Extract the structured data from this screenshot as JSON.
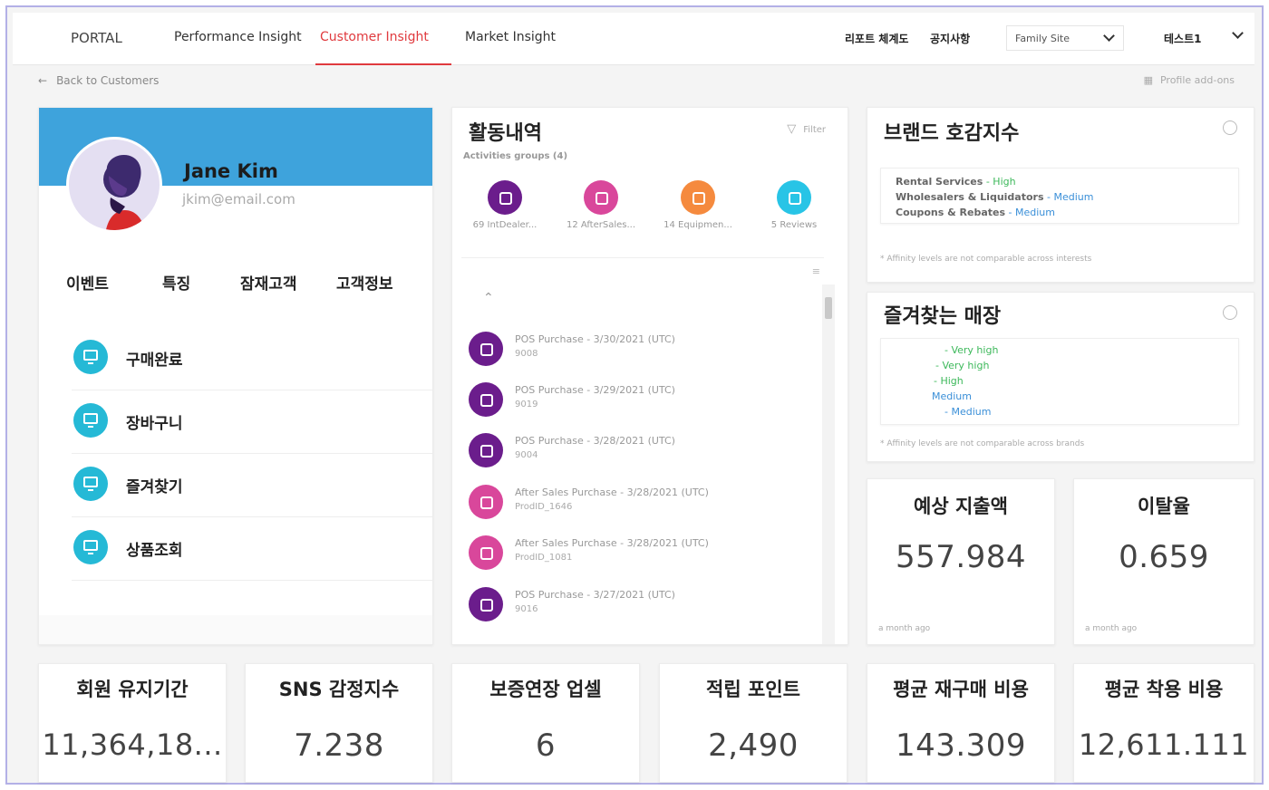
{
  "nav": {
    "portal": "PORTAL",
    "tabs": [
      "Performance Insight",
      "Customer Insight",
      "Market Insight"
    ],
    "active_tab": "Customer Insight",
    "right_links": [
      "리포트 체계도",
      "공지사항"
    ],
    "family_site": "Family Site",
    "user": "테스트1"
  },
  "subbar": {
    "back": "Back to Customers",
    "addons": "Profile add-ons"
  },
  "profile": {
    "name": "Jane Kim",
    "email": "jkim@email.com",
    "tabs": [
      "이벤트",
      "특징",
      "잠재고객",
      "고객정보"
    ],
    "events": [
      "구매완료",
      "장바구니",
      "즐겨찾기",
      "상품조회"
    ]
  },
  "activities": {
    "title": "활동내역",
    "filter": "Filter",
    "groups_label": "Activities groups (4)",
    "groups": [
      {
        "label": "69 IntDealer...",
        "color": "#6b1d8c"
      },
      {
        "label": "12 AfterSales...",
        "color": "#d9479b"
      },
      {
        "label": "14 Equipmen...",
        "color": "#f58a3e"
      },
      {
        "label": "5 Reviews",
        "color": "#28c4e6"
      }
    ],
    "items": [
      {
        "title": "POS Purchase - 3/30/2021 (UTC)",
        "sub": "9008",
        "color": "#6b1d8c"
      },
      {
        "title": "POS Purchase - 3/29/2021 (UTC)",
        "sub": "9019",
        "color": "#6b1d8c"
      },
      {
        "title": "POS Purchase - 3/28/2021 (UTC)",
        "sub": "9004",
        "color": "#6b1d8c"
      },
      {
        "title": "After Sales Purchase - 3/28/2021 (UTC)",
        "sub": "ProdID_1646",
        "color": "#d9479b"
      },
      {
        "title": "After Sales Purchase - 3/28/2021 (UTC)",
        "sub": "ProdID_1081",
        "color": "#d9479b"
      },
      {
        "title": "POS Purchase - 3/27/2021 (UTC)",
        "sub": "9016",
        "color": "#6b1d8c"
      }
    ]
  },
  "brand": {
    "title": "브랜드 호감지수",
    "rows": [
      {
        "name": "Rental Services",
        "level": "High"
      },
      {
        "name": "Wholesalers & Liquidators",
        "level": "Medium"
      },
      {
        "name": "Coupons & Rebates",
        "level": "Medium"
      }
    ],
    "note": "* Affinity levels are not comparable across interests"
  },
  "stores": {
    "title": "즐겨찾는 매장",
    "rows": [
      "- Very high",
      "- Very high",
      "- High",
      "Medium",
      "- Medium"
    ],
    "note": "* Affinity levels are not comparable across brands"
  },
  "metrics_top": [
    {
      "title": "예상 지출액",
      "value": "557.984",
      "foot": "a month ago"
    },
    {
      "title": "이탈율",
      "value": "0.659",
      "foot": "a month ago"
    }
  ],
  "metrics_bottom": [
    {
      "title": "회원 유지기간",
      "value": "11,364,18..."
    },
    {
      "title": "SNS 감정지수",
      "value": "7.238"
    },
    {
      "title": "보증연장 업셀",
      "value": "6"
    },
    {
      "title": "적립 포인트",
      "value": "2,490"
    },
    {
      "title": "평균 재구매 비용",
      "value": "143.309"
    },
    {
      "title": "평균 착용 비용",
      "value": "12,611.111"
    }
  ],
  "colors": {
    "accent": "#e03a3e",
    "banner": "#3ea3dc",
    "event_icon": "#25b9d6"
  }
}
